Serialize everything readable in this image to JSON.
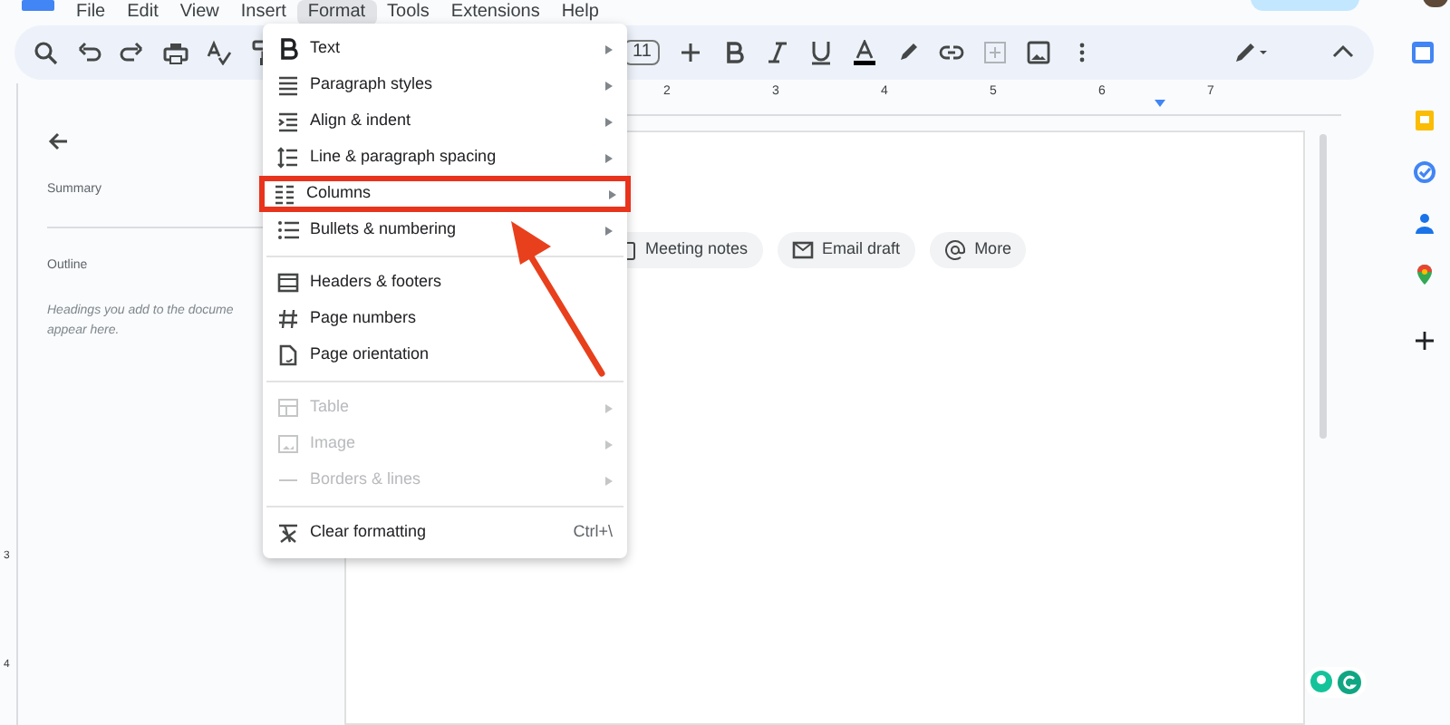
{
  "menu_bar": [
    {
      "label": "File",
      "selected": false
    },
    {
      "label": "Edit",
      "selected": false
    },
    {
      "label": "View",
      "selected": false
    },
    {
      "label": "Insert",
      "selected": false
    },
    {
      "label": "Format",
      "selected": true
    },
    {
      "label": "Tools",
      "selected": false
    },
    {
      "label": "Extensions",
      "selected": false
    },
    {
      "label": "Help",
      "selected": false
    }
  ],
  "toolbar": {
    "font_size": "11"
  },
  "ruler": {
    "top_numbers": [
      "2",
      "3",
      "4",
      "5",
      "6",
      "7"
    ],
    "side_numbers": [
      "3",
      "4"
    ]
  },
  "side_panel": {
    "summary_label": "Summary",
    "outline_label": "Outline",
    "outline_hint": "Headings you add to the docume\nappear here."
  },
  "chips": [
    {
      "label": "Meeting notes"
    },
    {
      "label": "Email draft"
    },
    {
      "label": "More"
    }
  ],
  "format_menu": {
    "sections": [
      [
        {
          "label": "Text",
          "submenu": true,
          "disabled": false,
          "highlighted": false
        },
        {
          "label": "Paragraph styles",
          "submenu": true,
          "disabled": false,
          "highlighted": false
        },
        {
          "label": "Align & indent",
          "submenu": true,
          "disabled": false,
          "highlighted": false
        },
        {
          "label": "Line & paragraph spacing",
          "submenu": true,
          "disabled": false,
          "highlighted": false
        },
        {
          "label": "Columns",
          "submenu": true,
          "disabled": false,
          "highlighted": true
        },
        {
          "label": "Bullets & numbering",
          "submenu": true,
          "disabled": false,
          "highlighted": false
        }
      ],
      [
        {
          "label": "Headers & footers",
          "submenu": false,
          "disabled": false,
          "highlighted": false
        },
        {
          "label": "Page numbers",
          "submenu": false,
          "disabled": false,
          "highlighted": false
        },
        {
          "label": "Page orientation",
          "submenu": false,
          "disabled": false,
          "highlighted": false
        }
      ],
      [
        {
          "label": "Table",
          "submenu": true,
          "disabled": true,
          "highlighted": false
        },
        {
          "label": "Image",
          "submenu": true,
          "disabled": true,
          "highlighted": false
        },
        {
          "label": "Borders & lines",
          "submenu": true,
          "disabled": true,
          "highlighted": false
        }
      ],
      [
        {
          "label": "Clear formatting",
          "submenu": false,
          "disabled": false,
          "highlighted": false,
          "shortcut": "Ctrl+\\"
        }
      ]
    ]
  }
}
